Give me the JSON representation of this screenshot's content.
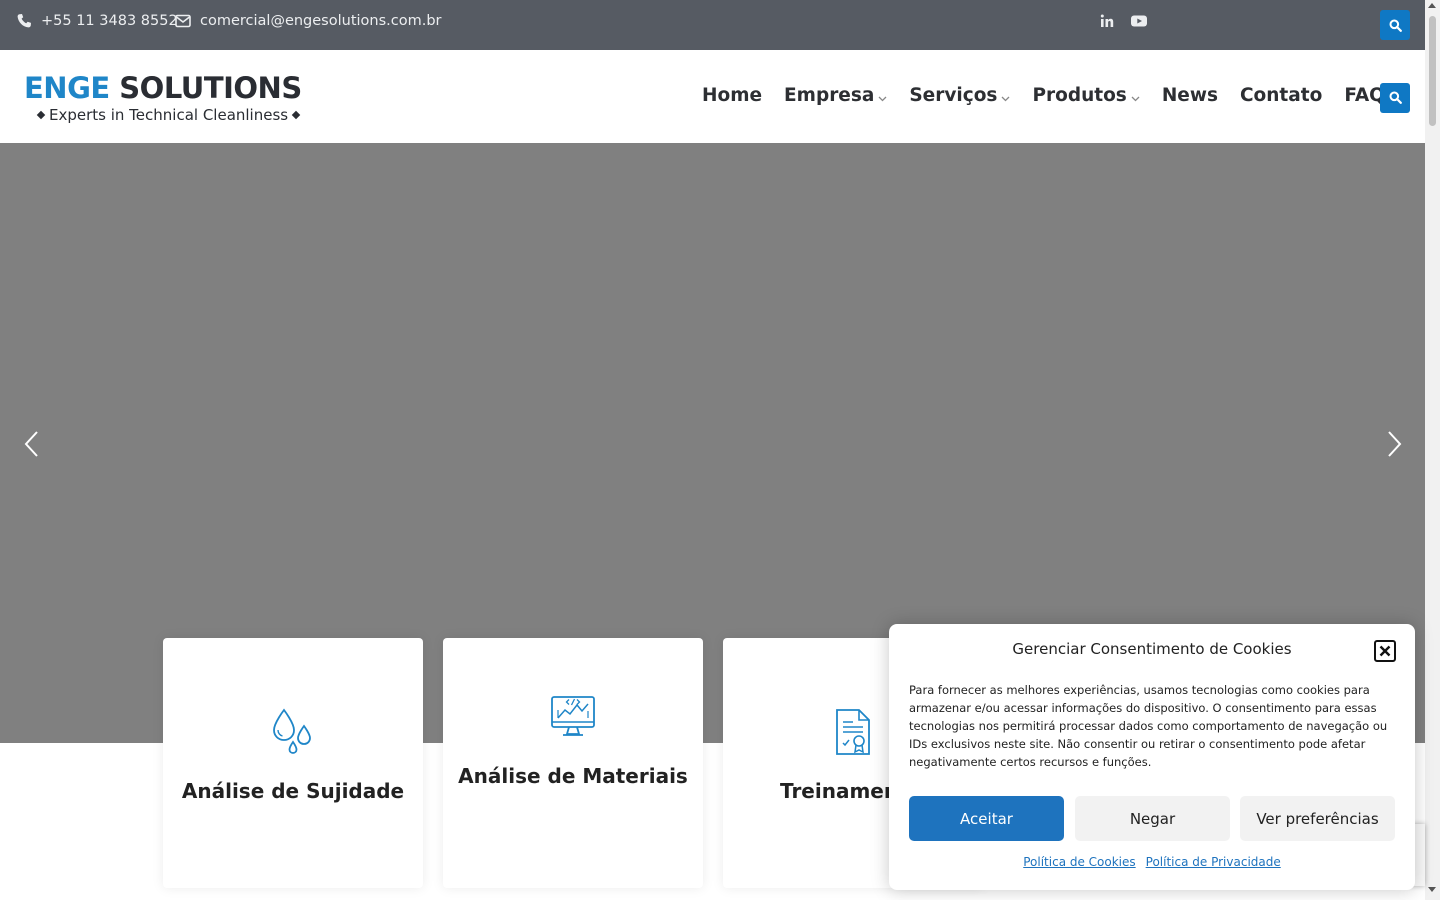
{
  "topbar": {
    "phone": "+55 11 3483 8552",
    "email": "comercial@engesolutions.com.br",
    "icons": {
      "phone": "phone-icon",
      "email": "envelope-icon",
      "linkedin": "linkedin-icon",
      "youtube": "youtube-icon",
      "search": "search-icon"
    }
  },
  "header": {
    "logo": {
      "part1": "ENGE",
      "part2": " SOLUTIONS",
      "tagline": "Experts in Technical Cleanliness"
    },
    "nav": [
      {
        "label": "Home",
        "dropdown": false
      },
      {
        "label": "Empresa",
        "dropdown": true
      },
      {
        "label": "Serviços",
        "dropdown": true
      },
      {
        "label": "Produtos",
        "dropdown": true
      },
      {
        "label": "News",
        "dropdown": false
      },
      {
        "label": "Contato",
        "dropdown": false
      },
      {
        "label": "FAQ’S",
        "dropdown": false
      }
    ]
  },
  "hero": {
    "background": "#808080",
    "prev_icon": "chevron-left-icon",
    "next_icon": "chevron-right-icon"
  },
  "cards": [
    {
      "title": "Análise de Sujidade",
      "icon": "water-drops-icon"
    },
    {
      "title": "Análise de Materiais",
      "icon": "monitor-chart-icon"
    },
    {
      "title": "Treinamen",
      "icon": "certificate-document-icon"
    }
  ],
  "cookie": {
    "title": "Gerenciar Consentimento de Cookies",
    "text": "Para fornecer as melhores experiências, usamos tecnologias como cookies para armazenar e/ou acessar informações do dispositivo. O consentimento para essas tecnologias nos permitirá processar dados como comportamento de navegação ou IDs exclusivos neste site. Não consentir ou retirar o consentimento pode afetar negativamente certos recursos e funções.",
    "accept": "Aceitar",
    "deny": "Negar",
    "preferences": "Ver preferências",
    "cookie_policy": "Política de Cookies",
    "privacy_policy": "Política de Privacidade"
  },
  "colors": {
    "topbar": "#565b63",
    "accent": "#0f78c4",
    "cookie_accept": "#1e73be"
  }
}
